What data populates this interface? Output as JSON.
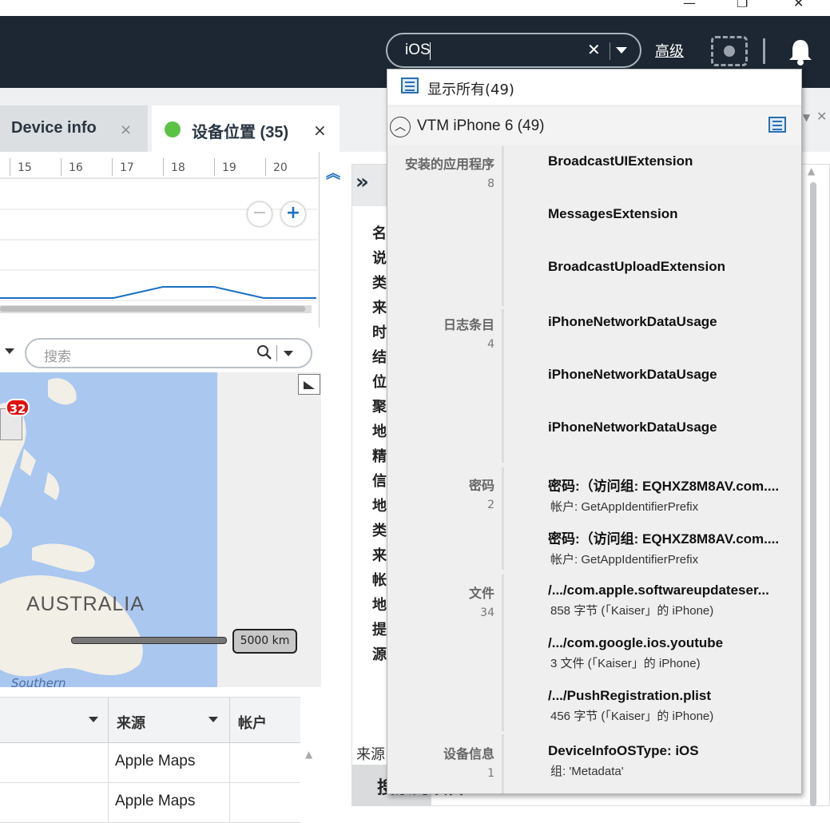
{
  "window": {
    "minimize": "—",
    "restore": "❐",
    "close": "✕"
  },
  "topbar": {
    "search_value": "iOS",
    "clear_glyph": "✕",
    "advanced_label": "高级"
  },
  "tabs": [
    {
      "label": "Device info",
      "close": "×"
    },
    {
      "label": "设备位置 (35)",
      "close": "×"
    }
  ],
  "timeline": {
    "ticks": [
      "15",
      "16",
      "17",
      "18",
      "19",
      "20"
    ],
    "zoom_out": "−",
    "zoom_in": "+"
  },
  "map": {
    "search_placeholder": "搜索",
    "cluster_count": "32",
    "region_label": "AUSTRALIA",
    "ocean_label": "Southern",
    "scale_label": "5000 km"
  },
  "table": {
    "headers": [
      "",
      "来源",
      "帐户"
    ],
    "rows": [
      [
        "",
        "Apple Maps",
        ""
      ],
      [
        "",
        "Apple Maps",
        ""
      ]
    ]
  },
  "right_panel": {
    "chevron": "»",
    "letters": [
      "名",
      "说",
      "类",
      "来",
      "时",
      "结",
      "位",
      "聚",
      "地",
      "精",
      "信",
      "地",
      "类",
      "来",
      "帐",
      "地",
      "提",
      "源"
    ],
    "footer_label": "来源",
    "footer_title": "搜索的项目"
  },
  "popup": {
    "show_all": "显示所有(49)",
    "device": "VTM iPhone 6   (49)",
    "categories": [
      {
        "name": "安装的应用程序",
        "count": "8"
      },
      {
        "name": "日志条目",
        "count": "4"
      },
      {
        "name": "密码",
        "count": "2"
      },
      {
        "name": "文件",
        "count": "34"
      },
      {
        "name": "设备信息",
        "count": "1"
      }
    ],
    "items": [
      {
        "title": "BroadcastUIExtension",
        "sub": ""
      },
      {
        "title": "MessagesExtension",
        "sub": ""
      },
      {
        "title": "BroadcastUploadExtension",
        "sub": ""
      },
      {
        "title": "iPhoneNetworkDataUsage",
        "sub": ""
      },
      {
        "title": "iPhoneNetworkDataUsage",
        "sub": ""
      },
      {
        "title": "iPhoneNetworkDataUsage",
        "sub": ""
      },
      {
        "title": "密码:（访问组: EQHXZ8M8AV.com....",
        "sub": "帐户: GetAppIdentifierPrefix"
      },
      {
        "title": "密码:（访问组: EQHXZ8M8AV.com....",
        "sub": "帐户: GetAppIdentifierPrefix"
      },
      {
        "title": "/.../com.apple.softwareupdateser...",
        "sub": "858 字节 (「Kaiser」的 iPhone)"
      },
      {
        "title": "/.../com.google.ios.youtube",
        "sub": "3 文件 (「Kaiser」的 iPhone)"
      },
      {
        "title": "/.../PushRegistration.plist",
        "sub": "456 字节 (「Kaiser」的 iPhone)"
      },
      {
        "title": "DeviceInfoOSType: iOS",
        "sub": "组: 'Metadata'"
      }
    ]
  },
  "colors": {
    "topbar": "#1c2733",
    "accent": "#1b6fc2",
    "status_green": "#5cc245",
    "badge_red": "#e01010"
  }
}
